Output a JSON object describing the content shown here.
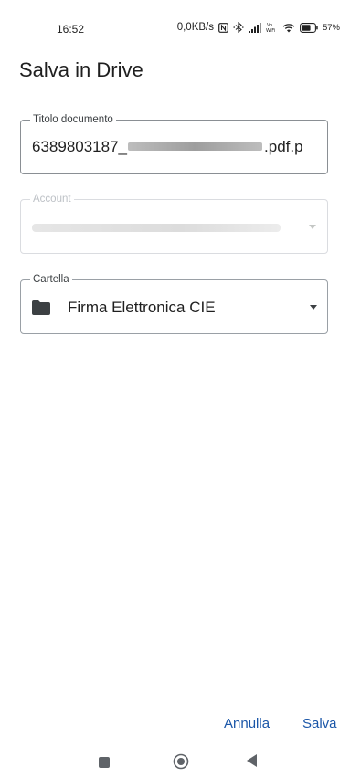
{
  "status_bar": {
    "time": "16:52",
    "net_speed": "0,0KB/s",
    "battery": "57%"
  },
  "title": "Salva in Drive",
  "fields": {
    "document_title": {
      "label": "Titolo documento",
      "value_prefix": "6389803187_",
      "value_suffix": ".pdf.p"
    },
    "account": {
      "label": "Account"
    },
    "folder": {
      "label": "Cartella",
      "value": "Firma Elettronica CIE",
      "icon": "folder-icon"
    }
  },
  "actions": {
    "cancel_label": "Annulla",
    "save_label": "Salva"
  },
  "colors": {
    "accent": "#1a56a8",
    "outline": "#9aa0a6"
  }
}
